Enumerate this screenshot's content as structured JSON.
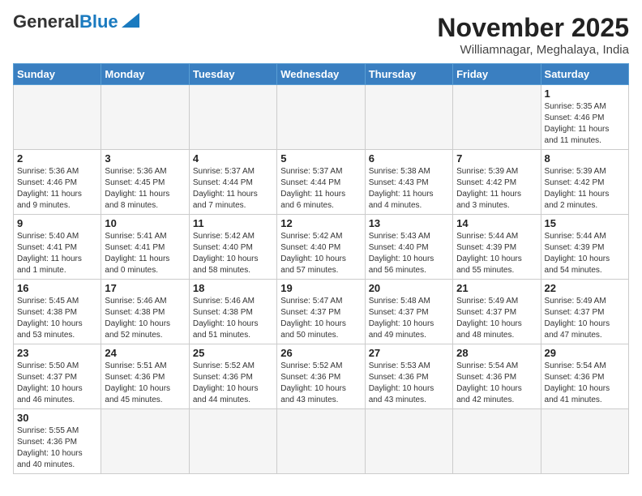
{
  "header": {
    "logo_general": "General",
    "logo_blue": "Blue",
    "title": "November 2025",
    "location": "Williamnagar, Meghalaya, India"
  },
  "days_of_week": [
    "Sunday",
    "Monday",
    "Tuesday",
    "Wednesday",
    "Thursday",
    "Friday",
    "Saturday"
  ],
  "weeks": [
    [
      {
        "day": "",
        "info": ""
      },
      {
        "day": "",
        "info": ""
      },
      {
        "day": "",
        "info": ""
      },
      {
        "day": "",
        "info": ""
      },
      {
        "day": "",
        "info": ""
      },
      {
        "day": "",
        "info": ""
      },
      {
        "day": "1",
        "info": "Sunrise: 5:35 AM\nSunset: 4:46 PM\nDaylight: 11 hours\nand 11 minutes."
      }
    ],
    [
      {
        "day": "2",
        "info": "Sunrise: 5:36 AM\nSunset: 4:46 PM\nDaylight: 11 hours\nand 9 minutes."
      },
      {
        "day": "3",
        "info": "Sunrise: 5:36 AM\nSunset: 4:45 PM\nDaylight: 11 hours\nand 8 minutes."
      },
      {
        "day": "4",
        "info": "Sunrise: 5:37 AM\nSunset: 4:44 PM\nDaylight: 11 hours\nand 7 minutes."
      },
      {
        "day": "5",
        "info": "Sunrise: 5:37 AM\nSunset: 4:44 PM\nDaylight: 11 hours\nand 6 minutes."
      },
      {
        "day": "6",
        "info": "Sunrise: 5:38 AM\nSunset: 4:43 PM\nDaylight: 11 hours\nand 4 minutes."
      },
      {
        "day": "7",
        "info": "Sunrise: 5:39 AM\nSunset: 4:42 PM\nDaylight: 11 hours\nand 3 minutes."
      },
      {
        "day": "8",
        "info": "Sunrise: 5:39 AM\nSunset: 4:42 PM\nDaylight: 11 hours\nand 2 minutes."
      }
    ],
    [
      {
        "day": "9",
        "info": "Sunrise: 5:40 AM\nSunset: 4:41 PM\nDaylight: 11 hours\nand 1 minute."
      },
      {
        "day": "10",
        "info": "Sunrise: 5:41 AM\nSunset: 4:41 PM\nDaylight: 11 hours\nand 0 minutes."
      },
      {
        "day": "11",
        "info": "Sunrise: 5:42 AM\nSunset: 4:40 PM\nDaylight: 10 hours\nand 58 minutes."
      },
      {
        "day": "12",
        "info": "Sunrise: 5:42 AM\nSunset: 4:40 PM\nDaylight: 10 hours\nand 57 minutes."
      },
      {
        "day": "13",
        "info": "Sunrise: 5:43 AM\nSunset: 4:40 PM\nDaylight: 10 hours\nand 56 minutes."
      },
      {
        "day": "14",
        "info": "Sunrise: 5:44 AM\nSunset: 4:39 PM\nDaylight: 10 hours\nand 55 minutes."
      },
      {
        "day": "15",
        "info": "Sunrise: 5:44 AM\nSunset: 4:39 PM\nDaylight: 10 hours\nand 54 minutes."
      }
    ],
    [
      {
        "day": "16",
        "info": "Sunrise: 5:45 AM\nSunset: 4:38 PM\nDaylight: 10 hours\nand 53 minutes."
      },
      {
        "day": "17",
        "info": "Sunrise: 5:46 AM\nSunset: 4:38 PM\nDaylight: 10 hours\nand 52 minutes."
      },
      {
        "day": "18",
        "info": "Sunrise: 5:46 AM\nSunset: 4:38 PM\nDaylight: 10 hours\nand 51 minutes."
      },
      {
        "day": "19",
        "info": "Sunrise: 5:47 AM\nSunset: 4:37 PM\nDaylight: 10 hours\nand 50 minutes."
      },
      {
        "day": "20",
        "info": "Sunrise: 5:48 AM\nSunset: 4:37 PM\nDaylight: 10 hours\nand 49 minutes."
      },
      {
        "day": "21",
        "info": "Sunrise: 5:49 AM\nSunset: 4:37 PM\nDaylight: 10 hours\nand 48 minutes."
      },
      {
        "day": "22",
        "info": "Sunrise: 5:49 AM\nSunset: 4:37 PM\nDaylight: 10 hours\nand 47 minutes."
      }
    ],
    [
      {
        "day": "23",
        "info": "Sunrise: 5:50 AM\nSunset: 4:37 PM\nDaylight: 10 hours\nand 46 minutes."
      },
      {
        "day": "24",
        "info": "Sunrise: 5:51 AM\nSunset: 4:36 PM\nDaylight: 10 hours\nand 45 minutes."
      },
      {
        "day": "25",
        "info": "Sunrise: 5:52 AM\nSunset: 4:36 PM\nDaylight: 10 hours\nand 44 minutes."
      },
      {
        "day": "26",
        "info": "Sunrise: 5:52 AM\nSunset: 4:36 PM\nDaylight: 10 hours\nand 43 minutes."
      },
      {
        "day": "27",
        "info": "Sunrise: 5:53 AM\nSunset: 4:36 PM\nDaylight: 10 hours\nand 43 minutes."
      },
      {
        "day": "28",
        "info": "Sunrise: 5:54 AM\nSunset: 4:36 PM\nDaylight: 10 hours\nand 42 minutes."
      },
      {
        "day": "29",
        "info": "Sunrise: 5:54 AM\nSunset: 4:36 PM\nDaylight: 10 hours\nand 41 minutes."
      }
    ],
    [
      {
        "day": "30",
        "info": "Sunrise: 5:55 AM\nSunset: 4:36 PM\nDaylight: 10 hours\nand 40 minutes."
      },
      {
        "day": "",
        "info": ""
      },
      {
        "day": "",
        "info": ""
      },
      {
        "day": "",
        "info": ""
      },
      {
        "day": "",
        "info": ""
      },
      {
        "day": "",
        "info": ""
      },
      {
        "day": "",
        "info": ""
      }
    ]
  ]
}
